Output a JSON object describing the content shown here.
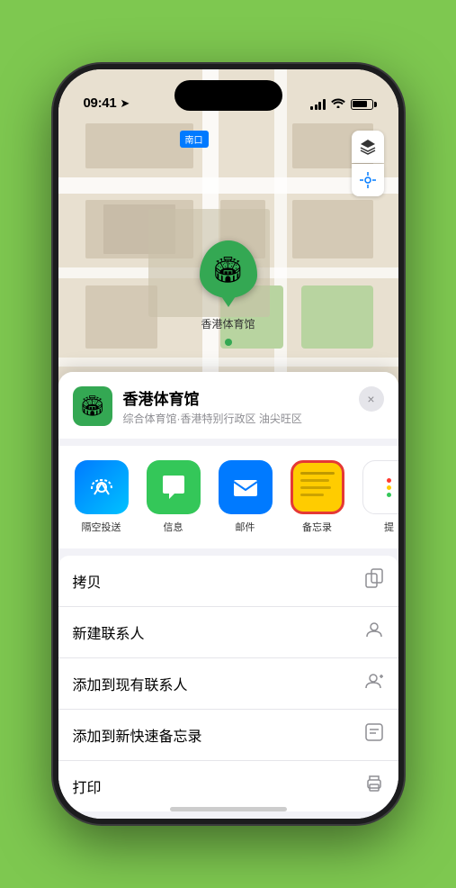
{
  "status_bar": {
    "time": "09:41",
    "location_arrow": "▶"
  },
  "map": {
    "label": "南口",
    "venue_pin_label": "香港体育馆"
  },
  "venue": {
    "name": "香港体育馆",
    "subtitle": "综合体育馆·香港特别行政区 油尖旺区",
    "logo_emoji": "🏟"
  },
  "close_button": "×",
  "share_items": [
    {
      "id": "airdrop",
      "label": "隔空投送",
      "type": "airdrop"
    },
    {
      "id": "message",
      "label": "信息",
      "type": "message"
    },
    {
      "id": "mail",
      "label": "邮件",
      "type": "mail"
    },
    {
      "id": "notes",
      "label": "备忘录",
      "type": "notes"
    },
    {
      "id": "more",
      "label": "提",
      "type": "more"
    }
  ],
  "action_items": [
    {
      "id": "copy",
      "label": "拷贝"
    },
    {
      "id": "new-contact",
      "label": "新建联系人"
    },
    {
      "id": "add-contact",
      "label": "添加到现有联系人"
    },
    {
      "id": "quick-notes",
      "label": "添加到新快速备忘录"
    },
    {
      "id": "print",
      "label": "打印"
    }
  ]
}
